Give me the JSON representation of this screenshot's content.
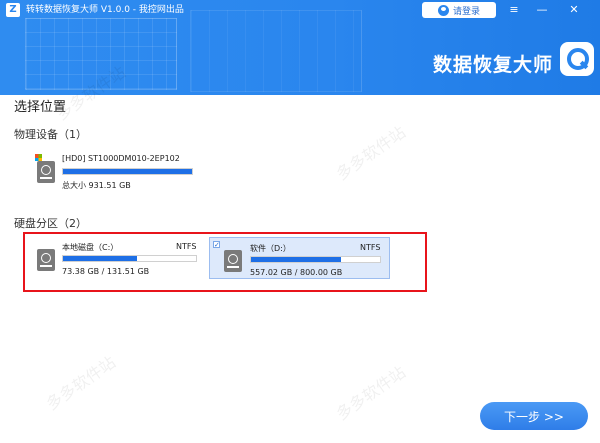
{
  "titlebar": {
    "logo": "Z",
    "title": "转转数据恢复大师 V1.0.0 - 我控网出品",
    "login_label": "请登录",
    "icons": [
      "user-icon",
      "menu-icon",
      "minimize-icon",
      "close-icon"
    ],
    "menu_glyph": "≡",
    "min_glyph": "—",
    "close_glyph": "✕"
  },
  "brand": {
    "text": "数据恢复大师",
    "icon": "magnifier-restore-icon"
  },
  "page": {
    "title": "选择位置"
  },
  "physical": {
    "heading": "物理设备（1）",
    "device": {
      "name": "[HD0] ST1000DM010-2EP102",
      "size_text": "总大小 931.51 GB",
      "usage": 1.0
    }
  },
  "partitions": {
    "heading": "硬盘分区（2）",
    "items": [
      {
        "name": "本地磁盘（C:）",
        "fs": "NTFS",
        "size_text": "73.38 GB / 131.51 GB",
        "usage": 0.558,
        "selected": false
      },
      {
        "name": "软件（D:）",
        "fs": "NTFS",
        "size_text": "557.02 GB / 800.00 GB",
        "usage": 0.696,
        "selected": true
      }
    ]
  },
  "footer": {
    "next_label": "下一步 >>"
  },
  "watermark": "多多软件站",
  "colors": {
    "accent": "#2a86ee",
    "bar": "#1e6fe6",
    "highlight": "#e8141b",
    "selected_bg": "#dde9fb"
  }
}
